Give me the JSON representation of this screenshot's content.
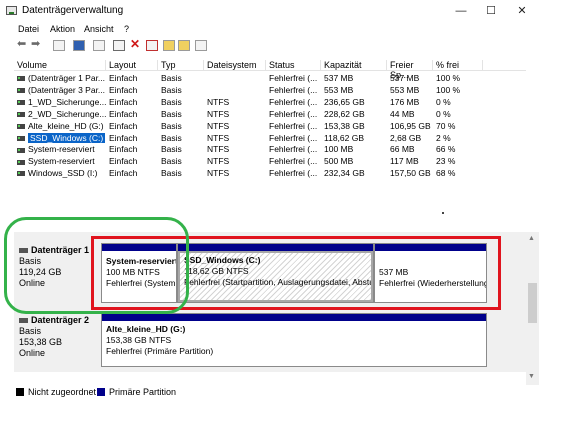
{
  "window": {
    "title": "Datenträgerverwaltung",
    "minimize": "—",
    "maximize": "☐",
    "close": "✕"
  },
  "menu": [
    "Datei",
    "Aktion",
    "Ansicht",
    "?"
  ],
  "table": {
    "headers": [
      "Volume",
      "Layout",
      "Typ",
      "Dateisystem",
      "Status",
      "Kapazität",
      "Freier Sp...",
      "% frei"
    ],
    "rows": [
      [
        "(Datenträger 1 Par...",
        "Einfach",
        "Basis",
        "",
        "Fehlerfrei (...",
        "537 MB",
        "537 MB",
        "100 %"
      ],
      [
        "(Datenträger 3 Par...",
        "Einfach",
        "Basis",
        "",
        "Fehlerfrei (...",
        "553 MB",
        "553 MB",
        "100 %"
      ],
      [
        "1_WD_Sicherunge...",
        "Einfach",
        "Basis",
        "NTFS",
        "Fehlerfrei (...",
        "236,65 GB",
        "176 MB",
        "0 %"
      ],
      [
        "2_WD_Sicherunge...",
        "Einfach",
        "Basis",
        "NTFS",
        "Fehlerfrei (...",
        "228,62 GB",
        "44 MB",
        "0 %"
      ],
      [
        "Alte_kleine_HD (G:)",
        "Einfach",
        "Basis",
        "NTFS",
        "Fehlerfrei (...",
        "153,38 GB",
        "106,95 GB",
        "70 %"
      ],
      [
        "SSD_Windows (C:)",
        "Einfach",
        "Basis",
        "NTFS",
        "Fehlerfrei (...",
        "118,62 GB",
        "2,68 GB",
        "2 %"
      ],
      [
        "System-reserviert",
        "Einfach",
        "Basis",
        "NTFS",
        "Fehlerfrei (...",
        "100 MB",
        "66 MB",
        "66 %"
      ],
      [
        "System-reserviert",
        "Einfach",
        "Basis",
        "NTFS",
        "Fehlerfrei (...",
        "500 MB",
        "117 MB",
        "23 %"
      ],
      [
        "Windows_SSD (I:)",
        "Einfach",
        "Basis",
        "NTFS",
        "Fehlerfrei (...",
        "232,34 GB",
        "157,50 GB",
        "68 %"
      ]
    ]
  },
  "disks": [
    {
      "name": "Datenträger 1",
      "type": "Basis",
      "size": "119,24 GB",
      "status": "Online",
      "partitions": [
        {
          "name": "System-reserviert",
          "size": "100 MB NTFS",
          "status": "Fehlerfrei (System"
        },
        {
          "name": "SSD_Windows (C:)",
          "size": "118,62 GB NTFS",
          "status": "Fehlerfrei (Startpartition, Auslagerungsdatei, Absturzabbild"
        },
        {
          "name": "",
          "size": "537 MB",
          "status": "Fehlerfrei (Wiederherstellungspartition)"
        }
      ]
    },
    {
      "name": "Datenträger 2",
      "type": "Basis",
      "size": "153,38 GB",
      "status": "Online",
      "partitions": [
        {
          "name": "Alte_kleine_HD (G:)",
          "size": "153,38 GB NTFS",
          "status": "Fehlerfrei (Primäre Partition)"
        }
      ]
    }
  ],
  "legend": [
    {
      "label": "Nicht zugeordnet",
      "color": "#000000"
    },
    {
      "label": "Primäre Partition",
      "color": "#00008b"
    }
  ],
  "colors": {
    "partition_bar": "#00008b",
    "selection": "#0a64c8",
    "annotation_red": "#e0141e",
    "annotation_green": "#34b24a"
  }
}
